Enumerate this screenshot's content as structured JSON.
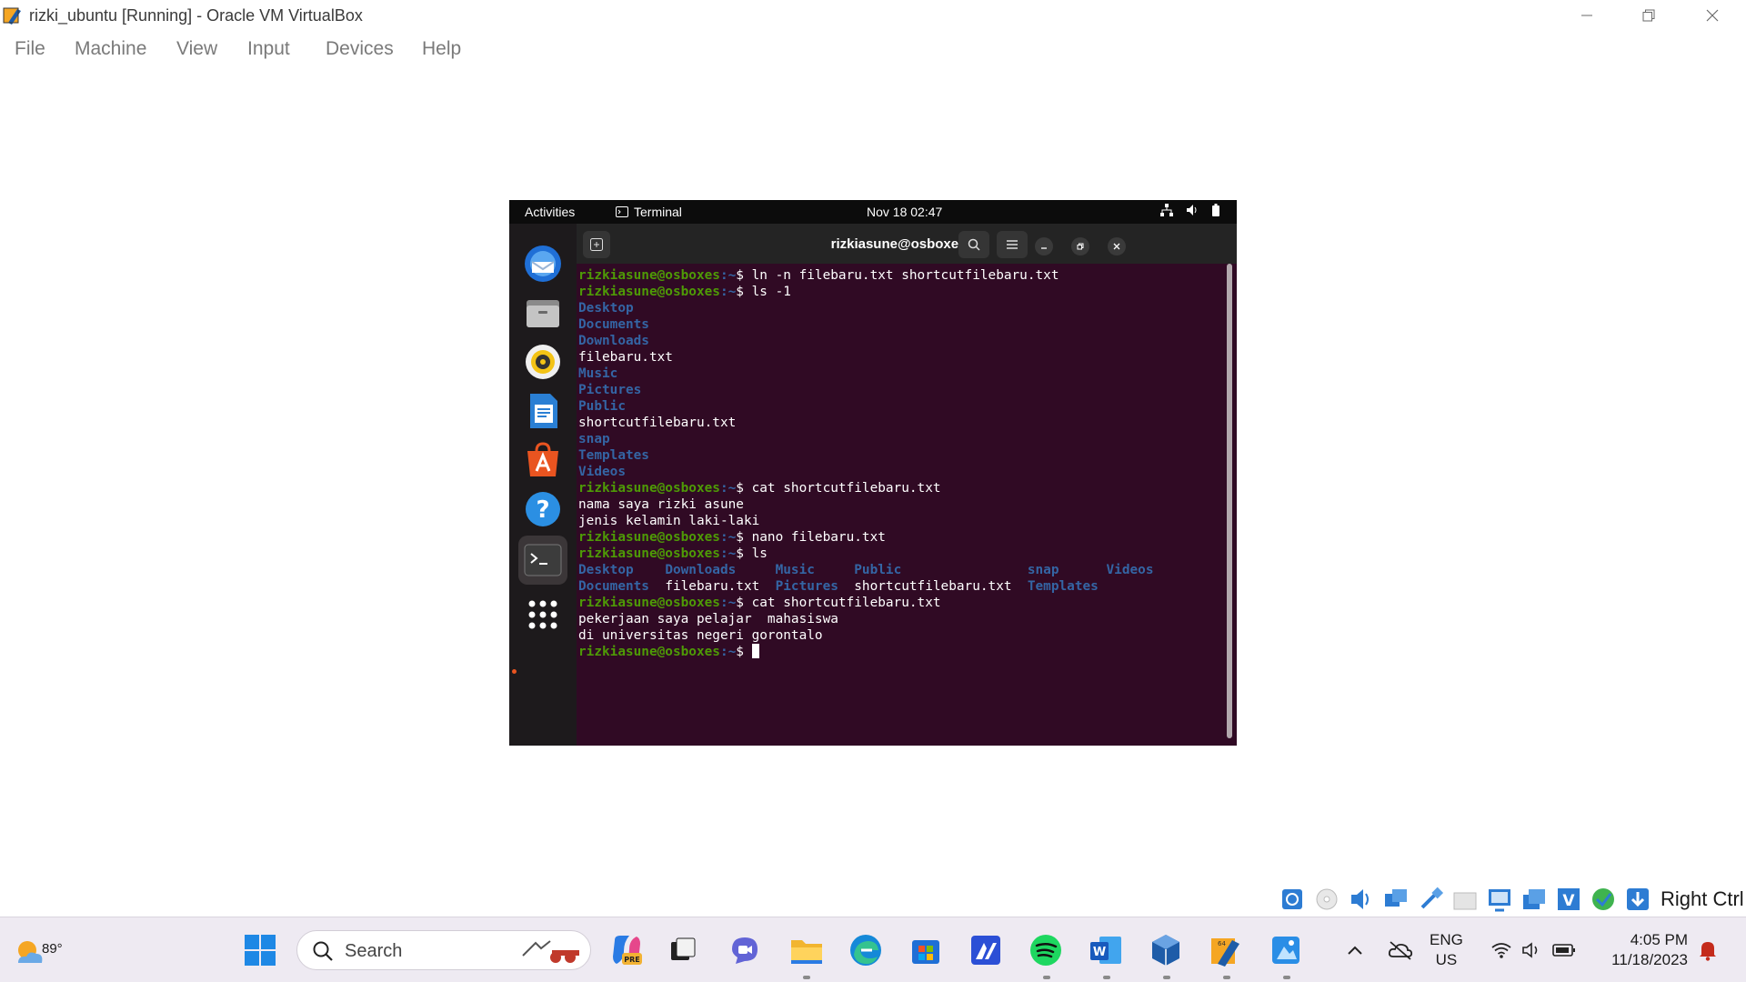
{
  "window": {
    "title": "rizki_ubuntu [Running] - Oracle VM VirtualBox",
    "controls": [
      "minimize-icon",
      "restore-icon",
      "close-icon"
    ]
  },
  "menubar": [
    "File",
    "Machine",
    "View",
    "Input",
    "Devices",
    "Help"
  ],
  "guest": {
    "topbar": {
      "activities": "Activities",
      "app": "Terminal",
      "clock": "Nov 18  02:47",
      "tray_icons": [
        "network-icon",
        "volume-icon",
        "battery-icon"
      ]
    },
    "dock": [
      "thunderbird-icon",
      "files-icon",
      "rhythmbox-icon",
      "writer-icon",
      "app-center-icon",
      "help-icon",
      "terminal-icon",
      "show-apps-icon"
    ],
    "terminal": {
      "title": "rizkiasune@osboxes: ~",
      "prompt_user": "rizkiasune@osboxes",
      "prompt_path": ":~",
      "prompt_suffix": "$ ",
      "lines": [
        {
          "type": "cmd",
          "text": "ln -n filebaru.txt shortcutfilebaru.txt"
        },
        {
          "type": "cmd",
          "text": "ls -1"
        },
        {
          "type": "dir",
          "text": "Desktop"
        },
        {
          "type": "dir",
          "text": "Documents"
        },
        {
          "type": "dir",
          "text": "Downloads"
        },
        {
          "type": "out",
          "text": "filebaru.txt"
        },
        {
          "type": "dir",
          "text": "Music"
        },
        {
          "type": "dir",
          "text": "Pictures"
        },
        {
          "type": "dir",
          "text": "Public"
        },
        {
          "type": "out",
          "text": "shortcutfilebaru.txt"
        },
        {
          "type": "dir",
          "text": "snap"
        },
        {
          "type": "dir",
          "text": "Templates"
        },
        {
          "type": "dir",
          "text": "Videos"
        },
        {
          "type": "cmd",
          "text": "cat shortcutfilebaru.txt"
        },
        {
          "type": "out",
          "text": "nama saya rizki asune"
        },
        {
          "type": "out",
          "text": "jenis kelamin laki-laki"
        },
        {
          "type": "cmd",
          "text": "nano filebaru.txt"
        },
        {
          "type": "cmd",
          "text": "ls"
        },
        {
          "type": "cols",
          "cells": [
            {
              "text": "Desktop    ",
              "dir": true
            },
            {
              "text": "Downloads     ",
              "dir": true
            },
            {
              "text": "Music     ",
              "dir": true
            },
            {
              "text": "Public                ",
              "dir": true
            },
            {
              "text": "snap      ",
              "dir": true
            },
            {
              "text": "Videos",
              "dir": true
            }
          ]
        },
        {
          "type": "cols",
          "cells": [
            {
              "text": "Documents  ",
              "dir": true
            },
            {
              "text": "filebaru.txt  ",
              "dir": false
            },
            {
              "text": "Pictures  ",
              "dir": true
            },
            {
              "text": "shortcutfilebaru.txt  ",
              "dir": false
            },
            {
              "text": "Templates",
              "dir": true
            }
          ]
        },
        {
          "type": "cmd",
          "text": "cat shortcutfilebaru.txt"
        },
        {
          "type": "out",
          "text": "pekerjaan saya pelajar  mahasiswa"
        },
        {
          "type": "out",
          "text": "di universitas negeri gorontalo"
        },
        {
          "type": "cmd",
          "text": "",
          "cursor": true
        }
      ]
    }
  },
  "statusbar": {
    "icons": [
      "hard-disk-icon",
      "optical-disk-icon",
      "audio-icon",
      "network-adapter-icon",
      "usb-icon",
      "shared-folders-icon",
      "display-icon",
      "recording-icon",
      "vbox-extension-icon",
      "guest-additions-icon",
      "download-icon"
    ],
    "host_key": "Right Ctrl"
  },
  "taskbar": {
    "weather": "89°",
    "search_placeholder": "Search",
    "apps": [
      "start-icon",
      "copilot-icon",
      "task-view-icon",
      "teams-icon",
      "file-explorer-icon",
      "edge-icon",
      "store-icon",
      "app-icon",
      "spotify-icon",
      "word-icon",
      "virtualbox-icon",
      "vbox-manager-icon",
      "paint-icon"
    ],
    "tray": {
      "lang_1": "ENG",
      "lang_2": "US",
      "time": "4:05 PM",
      "date": "11/18/2023"
    },
    "colors": {
      "accent": "#0067c0",
      "notification": "#c42b1c"
    }
  }
}
